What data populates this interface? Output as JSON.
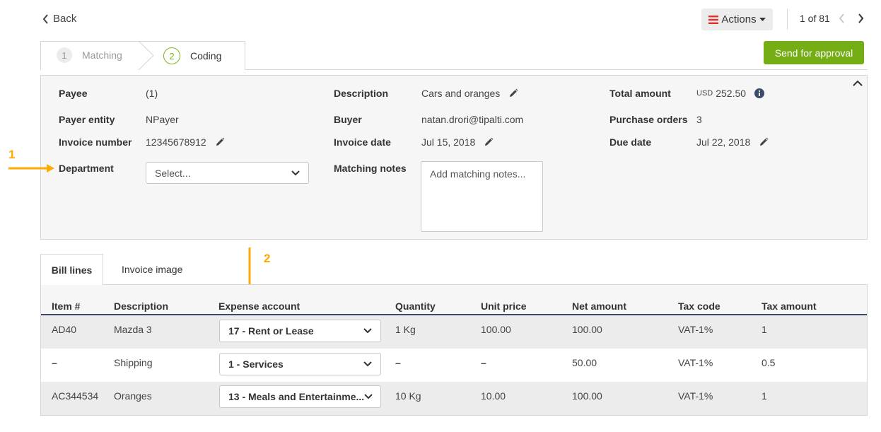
{
  "header": {
    "back_label": "Back",
    "actions_label": "Actions",
    "pager_text": "1 of 81",
    "send_label": "Send for approval"
  },
  "stepper": {
    "steps": [
      {
        "number": "1",
        "label": "Matching"
      },
      {
        "number": "2",
        "label": "Coding"
      }
    ]
  },
  "details": {
    "payee_label": "Payee",
    "payee_value": "(1)",
    "payer_entity_label": "Payer entity",
    "payer_entity_value": "NPayer",
    "invoice_number_label": "Invoice number",
    "invoice_number_value": "12345678912",
    "department_label": "Department",
    "department_placeholder": "Select...",
    "description_label": "Description",
    "description_value": "Cars and oranges",
    "buyer_label": "Buyer",
    "buyer_value": "natan.drori@tipalti.com",
    "invoice_date_label": "Invoice date",
    "invoice_date_value": "Jul 15, 2018",
    "matching_notes_label": "Matching notes",
    "matching_notes_placeholder": "Add matching notes...",
    "total_amount_label": "Total amount",
    "total_currency": "USD",
    "total_value": "252.50",
    "purchase_orders_label": "Purchase orders",
    "purchase_orders_value": "3",
    "due_date_label": "Due date",
    "due_date_value": "Jul 22, 2018"
  },
  "annotations": {
    "one": "1",
    "two": "2",
    "color": "#ffaa00"
  },
  "tabs": [
    {
      "label": "Bill lines"
    },
    {
      "label": "Invoice image"
    }
  ],
  "table": {
    "headers": [
      "Item #",
      "Description",
      "Expense account",
      "Quantity",
      "Unit price",
      "Net amount",
      "Tax code",
      "Tax amount"
    ],
    "rows": [
      {
        "item": "AD40",
        "description": "Mazda 3",
        "account": "17 - Rent or Lease",
        "quantity": "1 Kg",
        "unit_price": "100.00",
        "net": "100.00",
        "tax_code": "VAT-1%",
        "tax": "1"
      },
      {
        "item": "–",
        "description": "Shipping",
        "account": "1 - Services",
        "quantity": "–",
        "unit_price": "–",
        "net": "50.00",
        "tax_code": "VAT-1%",
        "tax": "0.5"
      },
      {
        "item": "AC344534",
        "description": "Oranges",
        "account": "13 - Meals and Entertainme...",
        "quantity": "10 Kg",
        "unit_price": "10.00",
        "net": "100.00",
        "tax_code": "VAT-1%",
        "tax": "1"
      }
    ]
  },
  "colors": {
    "accent_green": "#74ad14",
    "actions_red": "#e0302a",
    "header_navy": "#3a4a6b"
  },
  "icons": [
    "chevron-left-icon",
    "hamburger-icon",
    "caret-down-icon",
    "chevron-right-icon",
    "pencil-icon",
    "info-icon",
    "chevron-up-icon",
    "chevron-down-icon",
    "arrow-icon"
  ]
}
